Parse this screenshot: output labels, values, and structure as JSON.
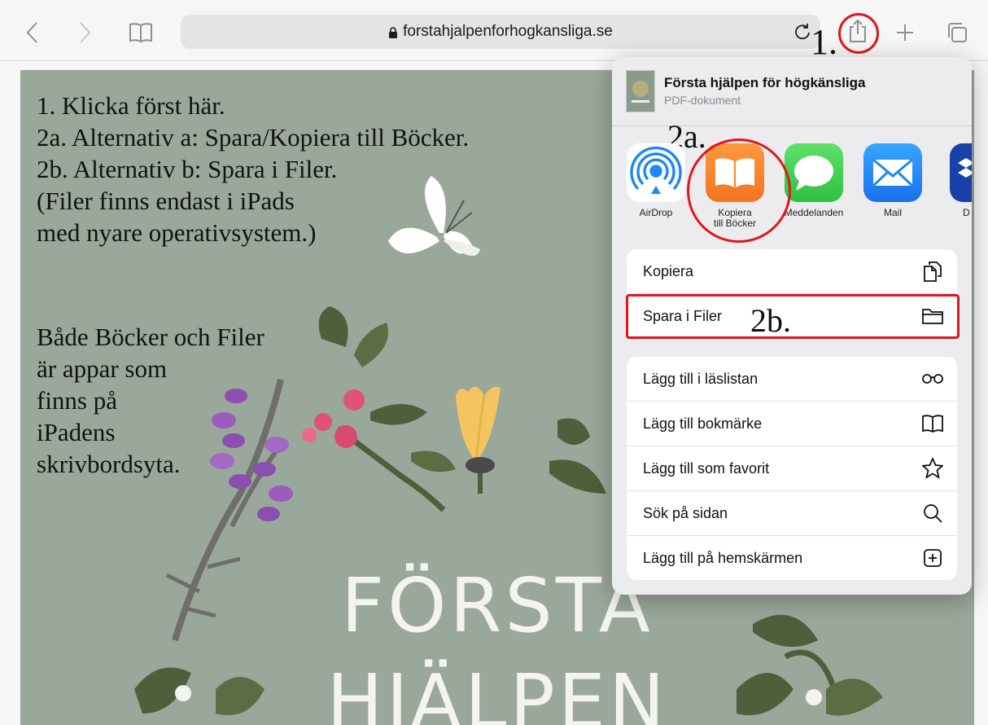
{
  "toolbar": {
    "url": "forstahjalpenforhogkansliga.se",
    "annotation_step1": "1."
  },
  "pdf": {
    "instructions": [
      "1. Klicka först här.",
      "2a. Alternativ a: Spara/Kopiera till Böcker.",
      "2b. Alternativ b: Spara i Filer.",
      "(Filer finns endast i iPads",
      "med nyare operativsystem.)"
    ],
    "note": [
      "Både Böcker och Filer",
      "är appar som",
      "finns på",
      "iPadens",
      "skrivbordsyta."
    ],
    "title_line1": "FÖRSTA",
    "title_line2": "HJÄLPEN"
  },
  "share_sheet": {
    "doc_title": "Första hjälpen för högkänsliga",
    "doc_subtitle": "PDF-dokument",
    "annotation_2a": "2a.",
    "annotation_2b": "2b.",
    "apps": [
      {
        "label": "AirDrop",
        "icon": "airdrop-icon"
      },
      {
        "label": "Kopiera\ntill Böcker",
        "icon": "books-icon"
      },
      {
        "label": "Meddelanden",
        "icon": "messages-icon"
      },
      {
        "label": "Mail",
        "icon": "mail-icon"
      },
      {
        "label": "D",
        "icon": "dropbox-icon"
      }
    ],
    "actions_group1": [
      {
        "label": "Kopiera",
        "icon": "copy-icon"
      },
      {
        "label": "Spara i Filer",
        "icon": "folder-icon"
      }
    ],
    "actions_group2": [
      {
        "label": "Lägg till i läslistan",
        "icon": "glasses-icon"
      },
      {
        "label": "Lägg till bokmärke",
        "icon": "book-icon"
      },
      {
        "label": "Lägg till som favorit",
        "icon": "star-icon"
      },
      {
        "label": "Sök på sidan",
        "icon": "search-icon"
      },
      {
        "label": "Lägg till på hemskärmen",
        "icon": "add-square-icon"
      }
    ]
  },
  "colors": {
    "annotation_red": "#e0161c",
    "pdf_background": "#9aa79b",
    "books_orange": "#f7852a",
    "messages_green": "#34c759",
    "mail_blue": "#1e88f5"
  }
}
